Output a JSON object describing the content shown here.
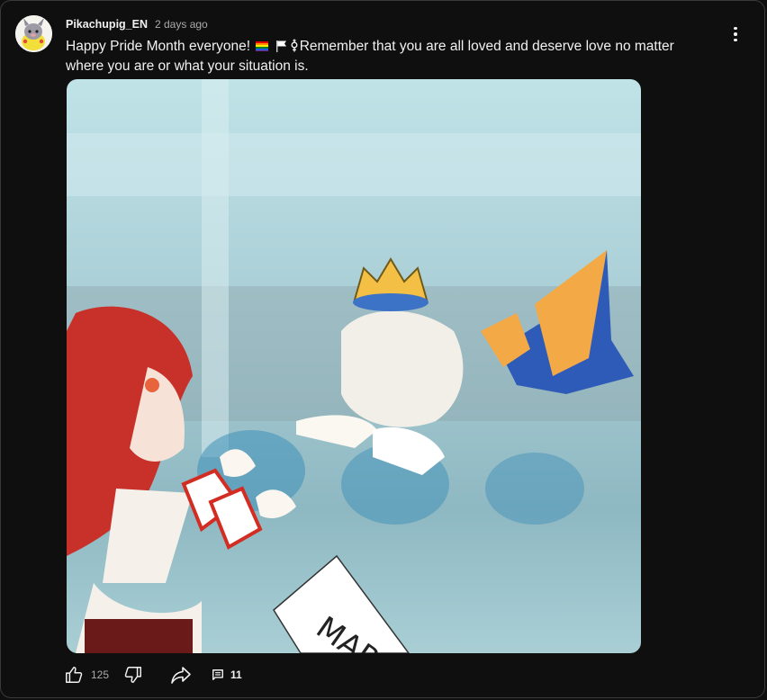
{
  "post": {
    "author": "Pikachupig_EN",
    "time": "2 days ago",
    "text_before_flags": "Happy Pride Month everyone! ",
    "text_after_flags": "Remember that you are all loved and deserve love no matter where you are or what your situation is.",
    "text_emojis": [
      "rainbow-flag",
      "white-flag",
      "transgender-symbol"
    ],
    "image_sign_text": "MAR"
  },
  "actions": {
    "like_count": "125",
    "comment_count": "11",
    "icons": [
      "thumbs-up-icon",
      "thumbs-down-icon",
      "share-icon",
      "comment-icon"
    ]
  },
  "menu_icon": "more-vert-icon",
  "colors": {
    "background": "#0f0f0f",
    "border": "#3a3a3a",
    "text": "#f1f1f1",
    "secondary_text": "#aaaaaa"
  }
}
